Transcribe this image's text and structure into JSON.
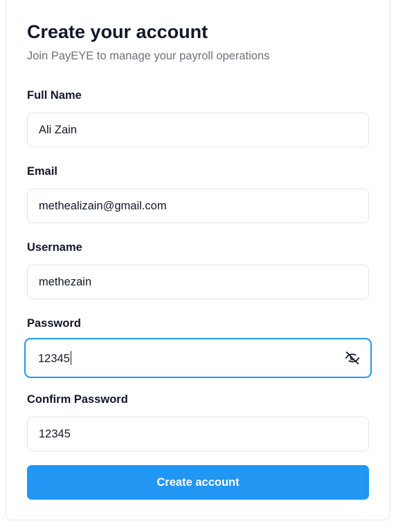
{
  "header": {
    "title": "Create your account",
    "subtitle": "Join PayEYE to manage your payroll operations"
  },
  "form": {
    "full_name": {
      "label": "Full Name",
      "value": "Ali Zain"
    },
    "email": {
      "label": "Email",
      "value": "methealizain@gmail.com"
    },
    "username": {
      "label": "Username",
      "value": "methezain"
    },
    "password": {
      "label": "Password",
      "value": "12345",
      "toggle_icon": "eye-off-icon"
    },
    "confirm_password": {
      "label": "Confirm Password",
      "value": "12345"
    },
    "submit_label": "Create account"
  },
  "colors": {
    "accent": "#2196f3",
    "title_text": "#111827",
    "muted_text": "#6b7280",
    "border": "#e5e7eb"
  }
}
